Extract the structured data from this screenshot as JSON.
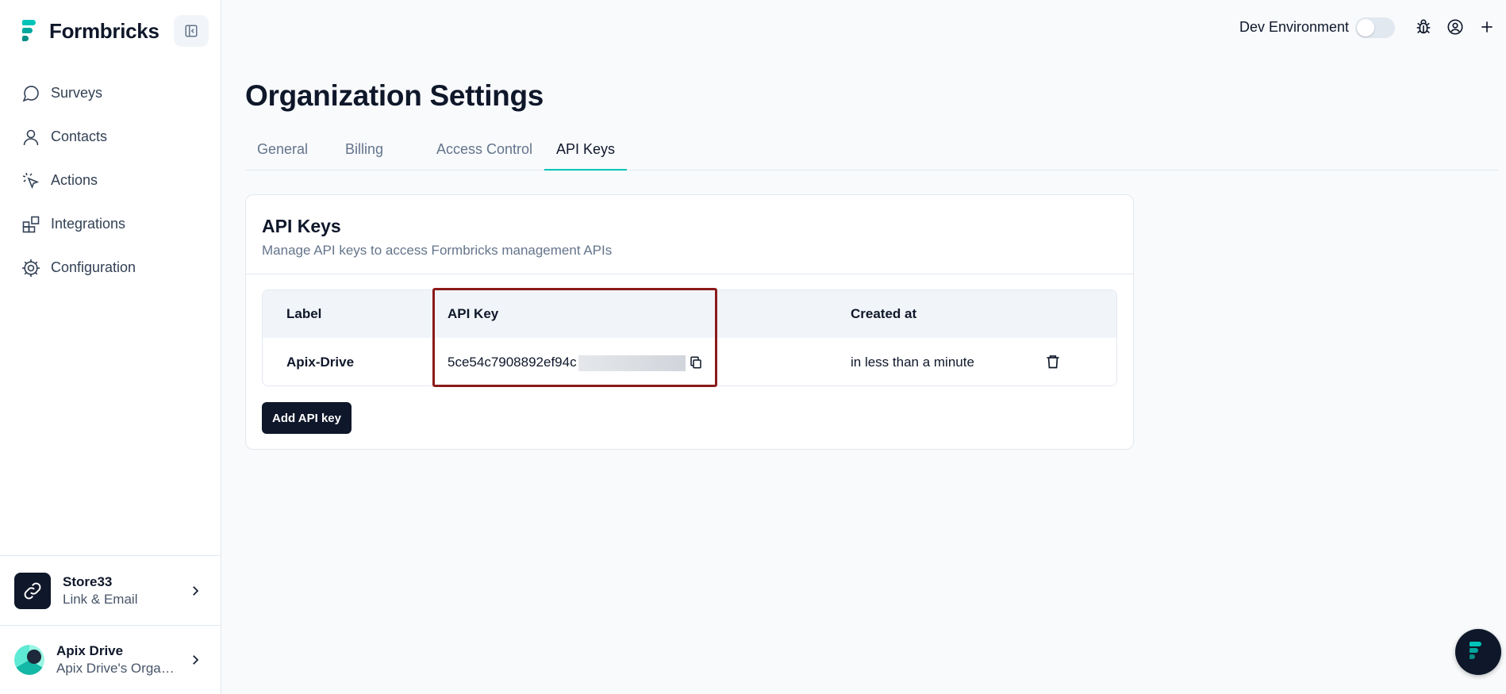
{
  "brand": {
    "name": "Formbricks"
  },
  "sidebar": {
    "items": [
      {
        "label": "Surveys",
        "icon": "message-circle-icon"
      },
      {
        "label": "Contacts",
        "icon": "user-icon"
      },
      {
        "label": "Actions",
        "icon": "mouse-pointer-click-icon"
      },
      {
        "label": "Integrations",
        "icon": "blocks-icon"
      },
      {
        "label": "Configuration",
        "icon": "gear-icon"
      }
    ],
    "project": {
      "name": "Store33",
      "subtitle": "Link & Email"
    },
    "user": {
      "name": "Apix Drive",
      "org": "Apix Drive's Organization"
    }
  },
  "topbar": {
    "env_label": "Dev Environment",
    "env_enabled": false
  },
  "page": {
    "title": "Organization Settings",
    "tabs": [
      {
        "label": "General",
        "active": false
      },
      {
        "label": "Billing",
        "active": false
      },
      {
        "label": "Access Control",
        "active": false
      },
      {
        "label": "API Keys",
        "active": true
      }
    ]
  },
  "card": {
    "title": "API Keys",
    "subtitle": "Manage API keys to access Formbricks management APIs",
    "table": {
      "headers": {
        "label": "Label",
        "api_key": "API Key",
        "created_at": "Created at"
      },
      "rows": [
        {
          "label": "Apix-Drive",
          "api_key": "5ce54c7908892ef94c",
          "created_at": "in less than a minute"
        }
      ]
    },
    "add_button": "Add API key"
  },
  "colors": {
    "accent": "#00c4b8",
    "dark": "#0f172a",
    "highlight": "#8b1a1a"
  }
}
